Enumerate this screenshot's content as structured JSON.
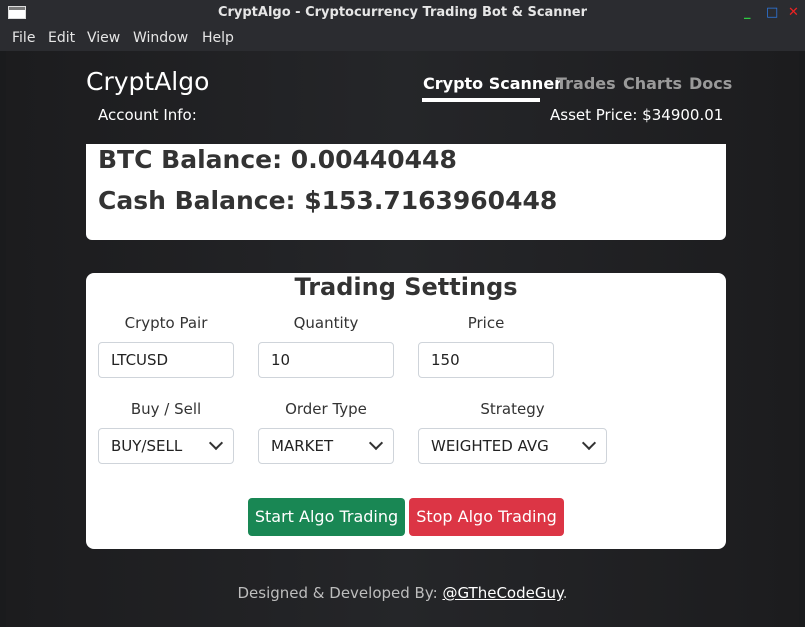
{
  "window": {
    "title": "CryptAlgo - Cryptocurrency Trading Bot & Scanner",
    "controls": {
      "minimize": "_",
      "maximize": "□",
      "close": "✕"
    }
  },
  "menu": [
    "File",
    "Edit",
    "View",
    "Window",
    "Help"
  ],
  "brand": "CryptAlgo",
  "nav": {
    "tabs": [
      {
        "label": "Crypto Scanner",
        "active": true
      },
      {
        "label": "Trades",
        "active": false
      },
      {
        "label": "Charts",
        "active": false
      },
      {
        "label": "Docs",
        "active": false
      }
    ]
  },
  "account": {
    "label": "Account Info:",
    "asset_price": "Asset Price: $34900.01"
  },
  "balances": {
    "btc": "BTC Balance: 0.00440448",
    "cash": "Cash Balance: $153.7163960448"
  },
  "settings": {
    "title": "Trading Settings",
    "fields": {
      "pair": {
        "label": "Crypto Pair",
        "value": "LTCUSD"
      },
      "quantity": {
        "label": "Quantity",
        "value": "10"
      },
      "price": {
        "label": "Price",
        "value": "150"
      },
      "side": {
        "label": "Buy / Sell",
        "value": "BUY/SELL"
      },
      "order_type": {
        "label": "Order Type",
        "value": "MARKET"
      },
      "strategy": {
        "label": "Strategy",
        "value": "WEIGHTED AVG"
      }
    },
    "start_button": "Start Algo Trading",
    "stop_button": "Stop Algo Trading"
  },
  "footer": {
    "text": "Designed & Developed By: ",
    "link": "@GTheCodeGuy",
    "suffix": "."
  },
  "colors": {
    "start": "#198754",
    "stop": "#dc3545"
  }
}
